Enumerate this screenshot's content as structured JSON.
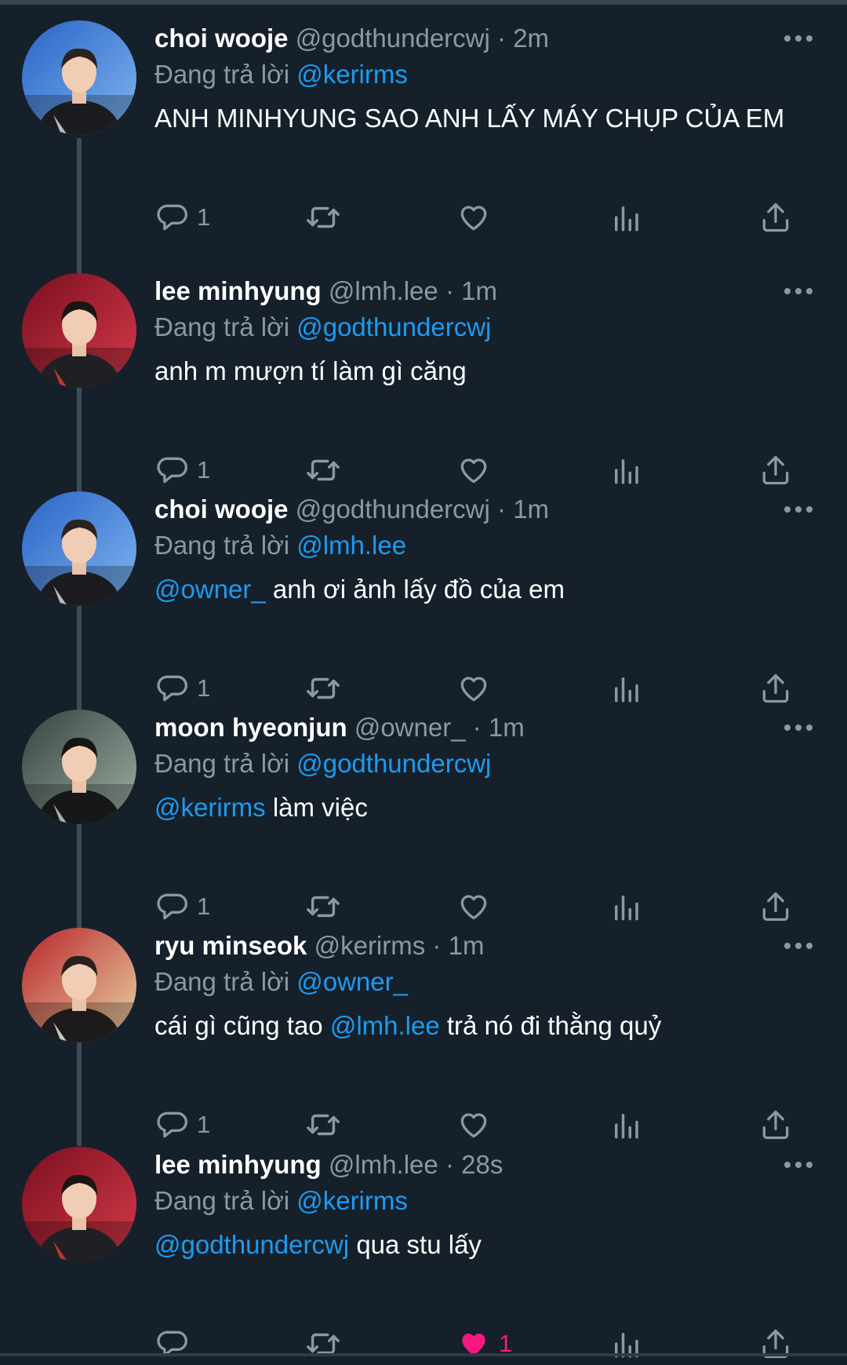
{
  "colors": {
    "background": "#15202b",
    "text_primary": "#ffffff",
    "text_secondary": "#8b98a5",
    "mention": "#1d9bf0",
    "like_active": "#f91880",
    "thread_line": "#3e4c59"
  },
  "reply_prefix": "Đang trả lời",
  "tweets": [
    {
      "name": "choi wooje",
      "handle": "@godthundercwj",
      "time": "2m",
      "replying_to": "@kerirms",
      "text_mention": "",
      "text": "ANH MINHYUNG SAO ANH LẤY MÁY CHỤP CỦA EM",
      "text_mention_mid": "",
      "text_after": "",
      "reply_count": "1",
      "like_count": "",
      "liked": false
    },
    {
      "name": "lee minhyung",
      "handle": "@lmh.lee",
      "time": "1m",
      "replying_to": "@godthundercwj",
      "text_mention": "",
      "text": "anh m mượn tí làm gì căng",
      "text_mention_mid": "",
      "text_after": "",
      "reply_count": "1",
      "like_count": "",
      "liked": false
    },
    {
      "name": "choi wooje",
      "handle": "@godthundercwj",
      "time": "1m",
      "replying_to": "@lmh.lee",
      "text_mention": "@owner_",
      "text": " anh ơi ảnh lấy đồ của em",
      "text_mention_mid": "",
      "text_after": "",
      "reply_count": "1",
      "like_count": "",
      "liked": false
    },
    {
      "name": "moon hyeonjun",
      "handle": "@owner_",
      "time": "1m",
      "replying_to": "@godthundercwj",
      "text_mention": "@kerirms",
      "text": " làm việc",
      "text_mention_mid": "",
      "text_after": "",
      "reply_count": "1",
      "like_count": "",
      "liked": false
    },
    {
      "name": "ryu minseok",
      "handle": "@kerirms",
      "time": "1m",
      "replying_to": "@owner_",
      "text_mention": "",
      "text": "cái gì cũng tao ",
      "text_mention_mid": "@lmh.lee",
      "text_after": " trả nó đi thằng quỷ",
      "reply_count": "1",
      "like_count": "",
      "liked": false
    },
    {
      "name": "lee minhyung",
      "handle": "@lmh.lee",
      "time": "28s",
      "replying_to": "@kerirms",
      "text_mention": "@godthundercwj",
      "text": " qua stu lấy",
      "text_mention_mid": "",
      "text_after": "",
      "reply_count": "",
      "like_count": "1",
      "liked": true
    }
  ]
}
